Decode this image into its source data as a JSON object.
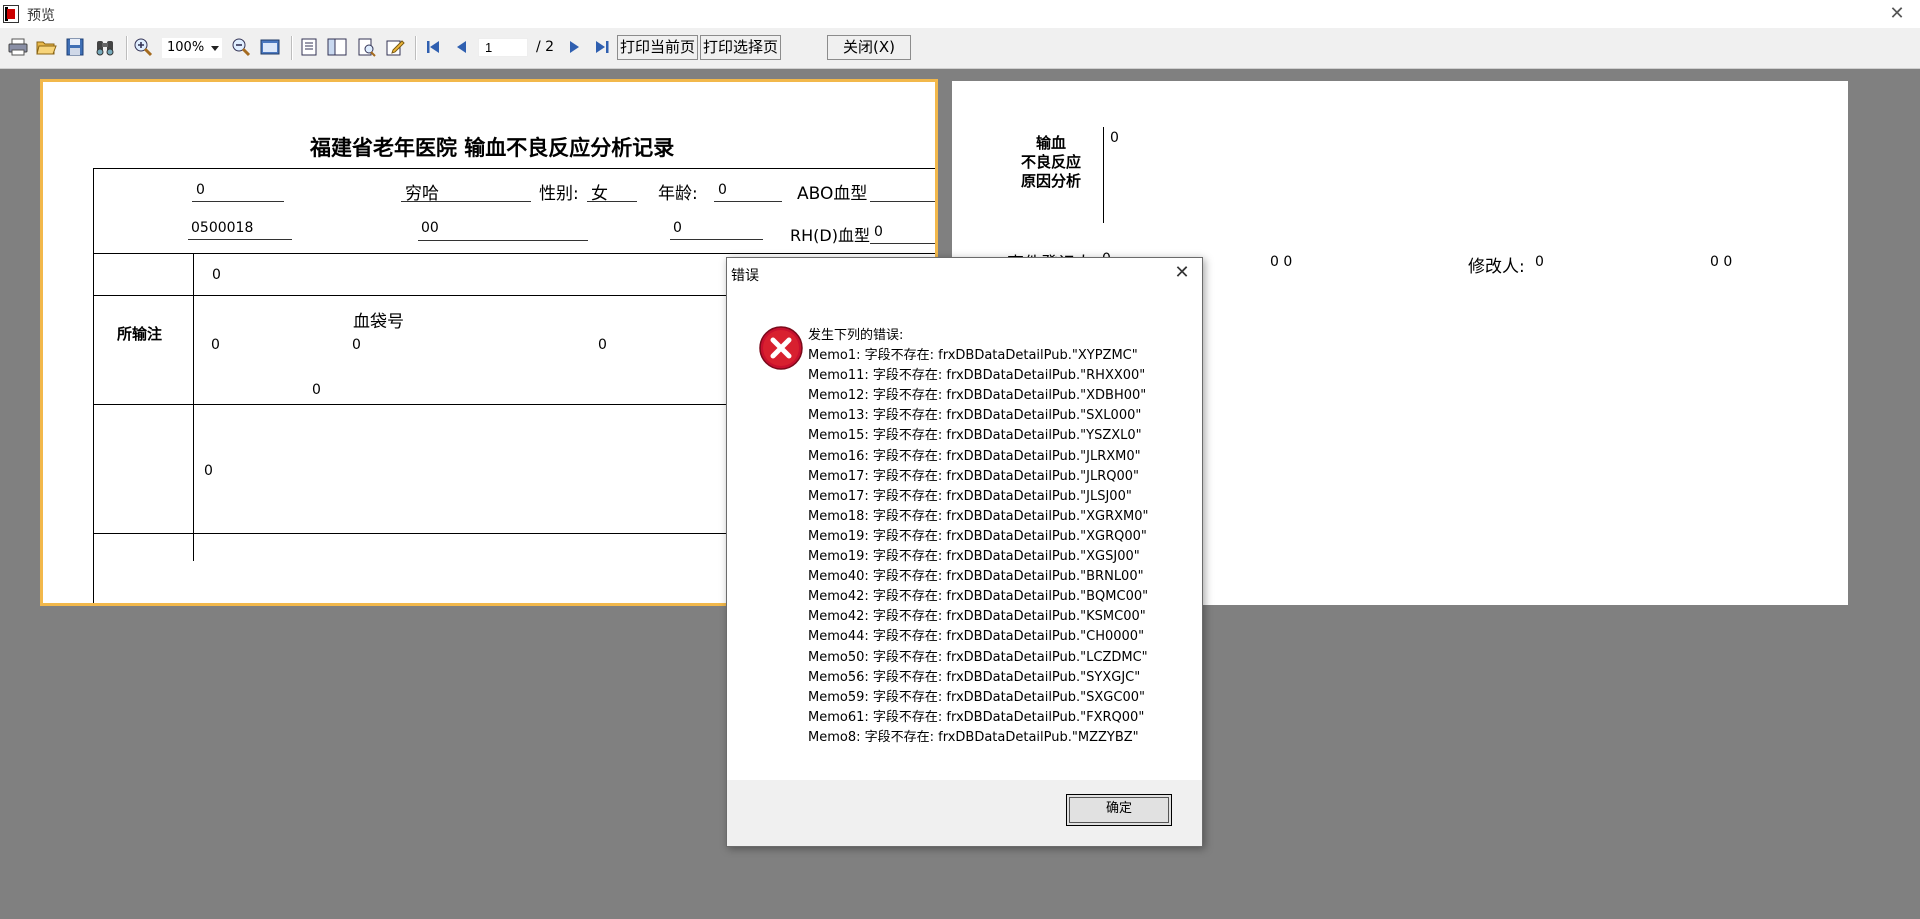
{
  "window": {
    "title": "预览"
  },
  "toolbar": {
    "zoom": "100%",
    "page_current": "1",
    "page_total": "/ 2",
    "print_current_label": "打印当前页",
    "print_selected_label": "打印选择页",
    "close_label": "关闭(X)"
  },
  "page1": {
    "title": "福建省老年医院    输血不良反应分析记录",
    "header_row1": {
      "field1": "0",
      "name": "穷哈",
      "sex_label": "性别:",
      "sex": "女",
      "age_label": "年龄:",
      "age": "0",
      "abo_label": "ABO血型"
    },
    "header_row2": {
      "id": "0500018",
      "field2": "00",
      "field3": "0",
      "rh_label": "RH(D)血型",
      "rh": "0"
    },
    "row_a": {
      "value": "0"
    },
    "transfused": {
      "label": "所输注",
      "bag_label": "血袋号",
      "v1": "0",
      "v2": "0",
      "v3": "0",
      "v4": "0"
    },
    "row_c": {
      "value": "0"
    }
  },
  "page2": {
    "cause_label_line1": "输血",
    "cause_label_line2": "不良反应",
    "cause_label_line3": "原因分析",
    "cause_value": "0",
    "register_label": "事件登记人:",
    "register_value": "0",
    "register_time": "0 0",
    "modifier_label": "修改人:",
    "modifier_value": "0",
    "modifier_time": "0 0"
  },
  "dialog": {
    "title": "错误",
    "heading": "发生下列的错误:",
    "messages": [
      "Memo1: 字段不存在: frxDBDataDetailPub.\"XYPZMC\"",
      "Memo11: 字段不存在: frxDBDataDetailPub.\"RHXX00\"",
      "Memo12: 字段不存在: frxDBDataDetailPub.\"XDBH00\"",
      "Memo13: 字段不存在: frxDBDataDetailPub.\"SXL000\"",
      "Memo15: 字段不存在: frxDBDataDetailPub.\"YSZXL0\"",
      "Memo16: 字段不存在: frxDBDataDetailPub.\"JLRXM0\"",
      "Memo17: 字段不存在: frxDBDataDetailPub.\"JLRQ00\"",
      "Memo17: 字段不存在: frxDBDataDetailPub.\"JLSJ00\"",
      "Memo18: 字段不存在: frxDBDataDetailPub.\"XGRXM0\"",
      "Memo19: 字段不存在: frxDBDataDetailPub.\"XGRQ00\"",
      "Memo19: 字段不存在: frxDBDataDetailPub.\"XGSJ00\"",
      "Memo40: 字段不存在: frxDBDataDetailPub.\"BRNL00\"",
      "Memo42: 字段不存在: frxDBDataDetailPub.\"BQMC00\"",
      "Memo42: 字段不存在: frxDBDataDetailPub.\"KSMC00\"",
      "Memo44: 字段不存在: frxDBDataDetailPub.\"CH0000\"",
      "Memo50: 字段不存在: frxDBDataDetailPub.\"LCZDMC\"",
      "Memo56: 字段不存在: frxDBDataDetailPub.\"SYXGJC\"",
      "Memo59: 字段不存在: frxDBDataDetailPub.\"SXGC00\"",
      "Memo61: 字段不存在: frxDBDataDetailPub.\"FXRQ00\"",
      "Memo8: 字段不存在: frxDBDataDetailPub.\"MZZYBZ\""
    ],
    "ok_label": "确定"
  },
  "colors": {
    "background": "#808080",
    "page_highlight": "#f2b84b",
    "error_red": "#c8102e"
  },
  "icons": [
    "print-icon",
    "open-icon",
    "save-icon",
    "find-icon",
    "zoom-in-icon",
    "zoom-out-icon",
    "fullscreen-icon",
    "outline-icon",
    "thumbnail-icon",
    "edit-icon",
    "page-setup-icon",
    "first-page-icon",
    "prev-page-icon",
    "next-page-icon",
    "last-page-icon",
    "error-icon",
    "close-icon"
  ]
}
